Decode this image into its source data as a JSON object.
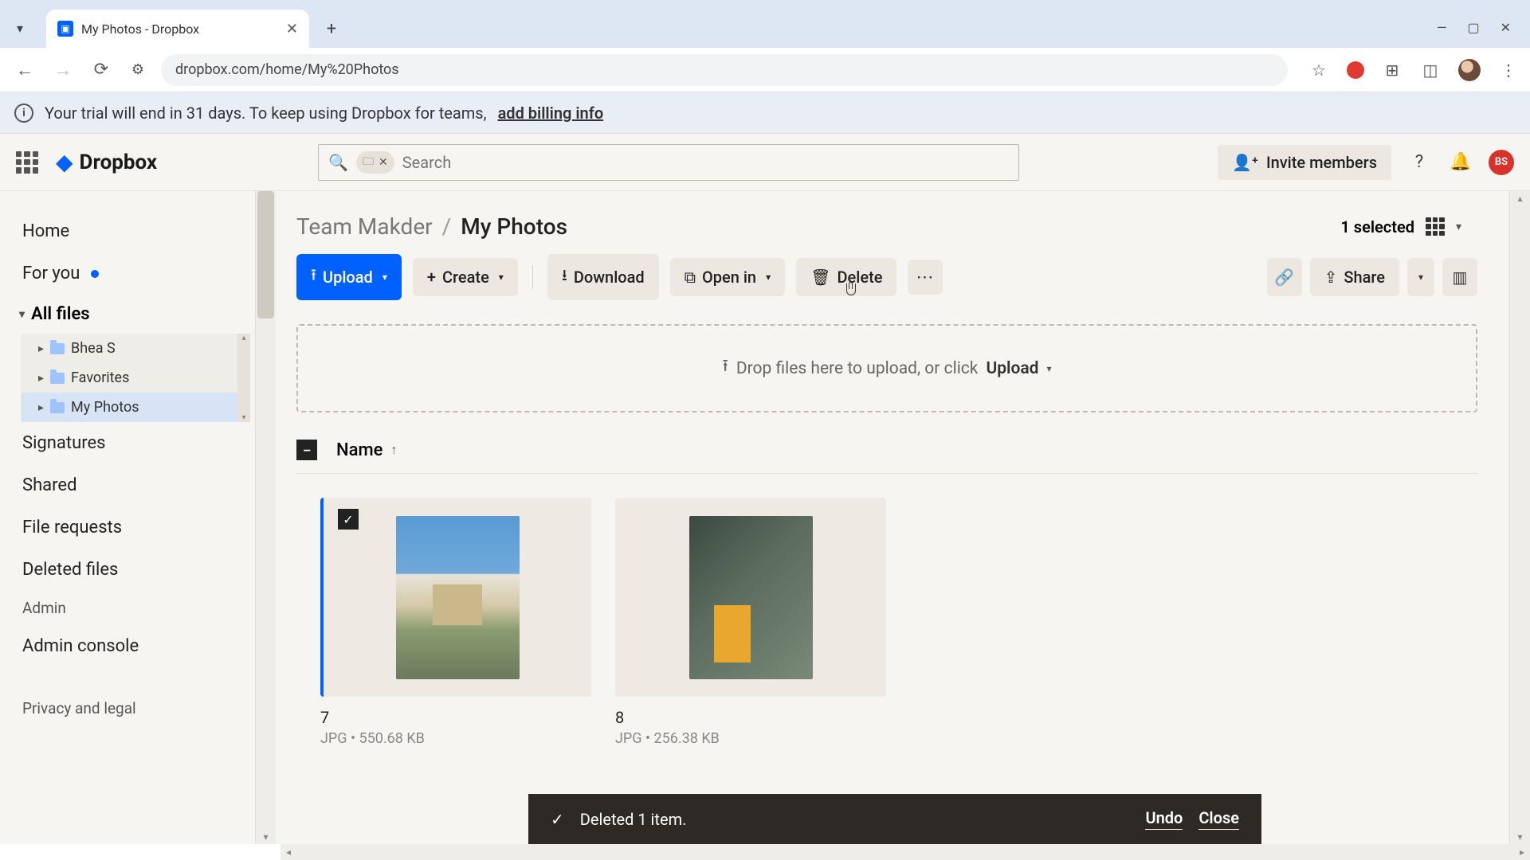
{
  "browser": {
    "tab_title": "My Photos - Dropbox",
    "url": "dropbox.com/home/My%20Photos"
  },
  "trial_banner": {
    "text": "Your trial will end in 31 days. To keep using Dropbox for teams,",
    "link": "add billing info"
  },
  "header": {
    "logo_text": "Dropbox",
    "search_placeholder": "Search",
    "invite_label": "Invite members",
    "avatar_initials": "BS"
  },
  "sidebar": {
    "home": "Home",
    "for_you": "For you",
    "all_files": "All files",
    "tree": {
      "items": [
        {
          "label": "Bhea S"
        },
        {
          "label": "Favorites"
        },
        {
          "label": "My Photos"
        }
      ]
    },
    "signatures": "Signatures",
    "shared": "Shared",
    "file_requests": "File requests",
    "deleted_files": "Deleted files",
    "admin": "Admin",
    "admin_console": "Admin console",
    "privacy": "Privacy and legal"
  },
  "breadcrumb": {
    "parent": "Team Makder",
    "current": "My Photos",
    "selected_count": "1 selected"
  },
  "toolbar": {
    "upload": "Upload",
    "create": "Create",
    "download": "Download",
    "open_in": "Open in",
    "delete": "Delete",
    "share": "Share"
  },
  "dropzone": {
    "text": "Drop files here to upload, or click",
    "upload_word": "Upload"
  },
  "table": {
    "col_name": "Name"
  },
  "files": [
    {
      "name": "7",
      "meta": "JPG • 550.68 KB",
      "selected": true,
      "thumb": "landscape"
    },
    {
      "name": "8",
      "meta": "JPG • 256.38 KB",
      "selected": false,
      "thumb": "urban"
    }
  ],
  "toast": {
    "message": "Deleted 1 item.",
    "undo": "Undo",
    "close": "Close"
  }
}
